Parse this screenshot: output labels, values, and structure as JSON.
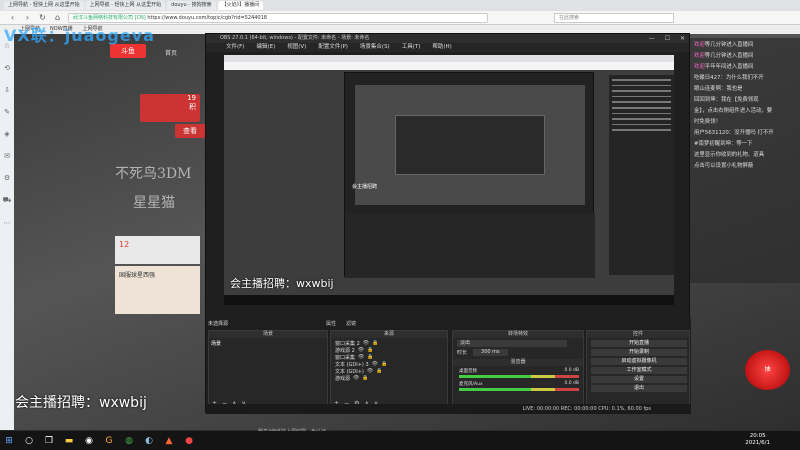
{
  "watermark": "VX联：juaogeva",
  "browser": {
    "tabs": [
      {
        "label": "上网导航 - 轻快上网 从这里开始",
        "active": false
      },
      {
        "label": "上网导航 - 轻快上网 从这里开始",
        "active": false
      },
      {
        "label": "douyu - 搜狗搜索",
        "active": false
      },
      {
        "label": "【火焰》】播播间",
        "active": true
      }
    ],
    "url_prefix": "武汉斗鱼网络科技有限公司 [CN]",
    "url": "https://www.douyu.com/topic/cgb?rid=5244018",
    "search_placeholder": "在此搜索",
    "bookmarks": [
      "上网导航",
      "NOW直播",
      "上网导航"
    ],
    "nav_icons": [
      "back-icon",
      "forward-icon",
      "refresh-icon",
      "home-icon"
    ]
  },
  "site": {
    "logo": "斗鱼",
    "nav_first": "首页",
    "promo_texts": [
      "19",
      "积",
      "查看"
    ],
    "calligraphy_1": "不死鸟3DM",
    "calligraphy_2": "星星猫",
    "counter_value": "12",
    "rank_title": "国服球星西强",
    "footer_text": "畅享3倍体验上周时限，免认证"
  },
  "chat": {
    "lines": [
      {
        "name": "欢迎",
        "text": "等几分钟进入直播间"
      },
      {
        "name": "欢迎",
        "text": "等几分钟进入直播间"
      },
      {
        "name": "欢迎",
        "text": "平年年间进入直播间"
      },
      {
        "name": "",
        "text": "吃碟日427：为什么我们不开"
      },
      {
        "name": "",
        "text": "眼山连麦啊：我也是"
      },
      {
        "name": "",
        "text": "回回到坤：我在【免费领现"
      },
      {
        "name": "",
        "text": "金】，点击右侧组件进入活动，要"
      },
      {
        "name": "",
        "text": "时免费领！"
      },
      {
        "name": "",
        "text": "用户5631120：没开播吗 打不开"
      },
      {
        "name": "",
        "text": "#南梦初醒到坤：等一下"
      },
      {
        "name": "",
        "text": "这里显示你收到的礼物、道具"
      },
      {
        "name": "",
        "text": "点击可以设置小礼物屏蔽"
      }
    ],
    "gift_label": "抽"
  },
  "obs": {
    "title": "OBS 27.0.1 (64-bit, windows) - 配置文件: 未命名 - 场景: 未命名",
    "menu": [
      "文件(F)",
      "编辑(E)",
      "视图(V)",
      "配置文件(P)",
      "场景集合(S)",
      "工具(T)",
      "帮助(H)"
    ],
    "preview_label": "未选择源",
    "dock_labels": {
      "scenes": "场景",
      "sources": "来源",
      "mixer": "转场特效",
      "controls": "控件"
    },
    "tool_buttons": [
      "属性",
      "滤镜"
    ],
    "scenes": [
      "场景"
    ],
    "sources": [
      "窗口采集 2",
      "游戏源 2",
      "窗口采集",
      "文本 (GDI+) 3",
      "文本 (GDI+)",
      "游戏源"
    ],
    "transition": {
      "name": "淡出",
      "duration_label": "时长",
      "duration": "300 ms"
    },
    "mixer": {
      "title": "混音器",
      "channels": [
        {
          "name": "桌面音频",
          "db": "0.0 dB"
        },
        {
          "name": "麦克风/Aux",
          "db": "0.0 dB"
        }
      ]
    },
    "controls": [
      "开始直播",
      "开始录制",
      "启动虚拟摄像机",
      "工作室模式",
      "设置",
      "退出"
    ],
    "status": "LIVE: 00:00:00   REC: 00:00:00   CPU: 0.1%, 60.00 fps"
  },
  "overlay": {
    "recruit_main": "会主播招聘：wxwbij",
    "recruit_preview": "会主播招聘：wxwbij",
    "preview_watermark": "会主播招聘"
  },
  "taskbar": {
    "time": "20:05",
    "date": "2021/6/1"
  }
}
